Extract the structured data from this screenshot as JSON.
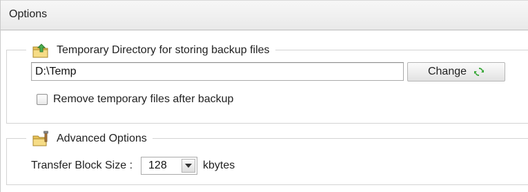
{
  "header": {
    "title": "Options"
  },
  "temp_section": {
    "legend": "Temporary Directory for storing backup files",
    "icon": "folder-up-icon",
    "path_value": "D:\\Temp",
    "change_label": "Change",
    "change_icon": "refresh-icon",
    "remove_checkbox_label": "Remove temporary files after backup",
    "remove_checked": false
  },
  "advanced_section": {
    "legend": "Advanced Options",
    "icon": "folder-tools-icon",
    "block_size_label": "Transfer Block Size :",
    "block_size_value": "128",
    "block_size_unit": "kbytes"
  },
  "colors": {
    "header_bg": "#ededed",
    "border": "#d3d3d3",
    "refresh_green": "#3aa83a",
    "folder_yellow": "#f2c94c"
  }
}
